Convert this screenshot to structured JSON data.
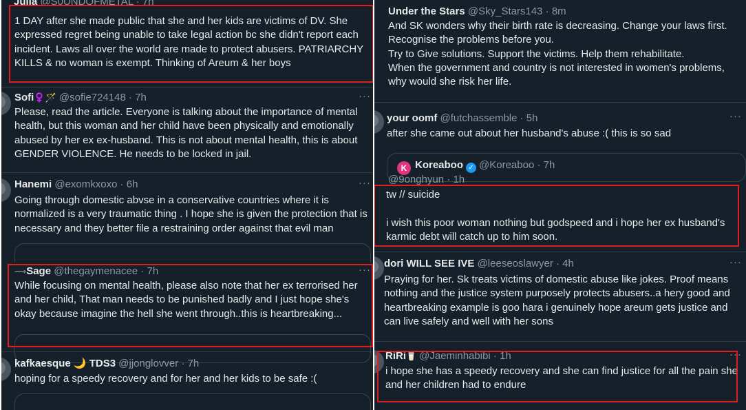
{
  "left": [
    {
      "name": "Julia",
      "handle": "@S0UNDOFMETAL",
      "time": "· 7h",
      "text": "1 DAY after she made public that she and her kids are victims of DV. She expressed regret being unable to take legal action bc she didn't report each incident. Laws all over the world are made to protect abusers. PATRIARCHY KILLS & no woman is exempt. Thinking of Areum & her boys"
    },
    {
      "name": "Sofi",
      "name_emoji": "♀️🪄",
      "handle": "@sofie724148",
      "time": "· 7h",
      "text": "Please, read the article. Everyone is talking about the importance of mental health, but this woman and her child have been physically and emotionally abused by her ex ex-husband. This is not about mental health, this is about GENDER VIOLENCE. He needs to be locked in jail."
    },
    {
      "name": "Hanemi",
      "handle": "@exomkxoxo",
      "time": "· 6h",
      "text": "Going through domestic abvse in a conservative countries where it is normalized is a very traumatic thing . I hope she is given the protection that is necessary and they better file a restraining order against that evil man"
    },
    {
      "name": "Sage",
      "handle": "@thegaymenacee",
      "time": "· 7h",
      "text": "While focusing on mental health, please also note that her ex terrorised her and her child, That man needs to be punished badly and I just hope she's okay because imagine the hell she went through..this is heartbreaking..."
    },
    {
      "name": "kafkaesque",
      "name_emoji": "🌙",
      "name_suffix": "TDS3",
      "handle": "@jjonglovver",
      "time": "· 7h",
      "text": "hoping for a speedy recovery and for her and her kids to be safe :("
    }
  ],
  "right": [
    {
      "name": "Under the Stars",
      "handle": "@Sky_Stars143",
      "time": "· 8m",
      "text": "And SK wonders why their birth rate is decreasing. Change your laws first.\nRecognise the problems before you.\nTry to Give solutions. Support the victims. Help them rehabilitate.\nWhen the government and country is not interested in women's problems, why would she risk her life."
    },
    {
      "name": "your oomf",
      "handle": "@futchassemble",
      "time": "· 5h",
      "text": "after she came out about her husband's abuse :( this is so sad",
      "quote": {
        "initial": "K",
        "name": "Koreaboo",
        "verified": "✓",
        "handle": "@Koreaboo",
        "time": "· 7h"
      }
    },
    {
      "name": "",
      "handle": "@9onghyun",
      "time": "· 1h",
      "text": "tw // suicide\n\ni wish this poor woman nothing but godspeed and i hope her ex husband's karmic debt will catch up to him soon."
    },
    {
      "name": "dori WILL SEE IVE",
      "handle": "@leeseoslawyer",
      "time": "· 4h",
      "text": "Praying for her. Sk treats victims of domestic abuse like jokes. Proof means nothing and the justice system purposely protects abusers..a hery good and heartbreaking example is goo hara i genuinely hope areum gets justice and can live safely and well with her sons"
    },
    {
      "name": "RiRi",
      "name_emoji": "🥛",
      "handle": "@Jaeminhabibi",
      "time": "· 1h",
      "text": "i hope she has a speedy recovery and she can find justice for all the pain she and her children had to endure"
    }
  ],
  "more_label": "···",
  "colors": {
    "background": "#15202b",
    "text": "#e7e9ea",
    "muted": "#8b98a5",
    "highlight": "#e01f1f",
    "verified": "#1d9bf0"
  }
}
